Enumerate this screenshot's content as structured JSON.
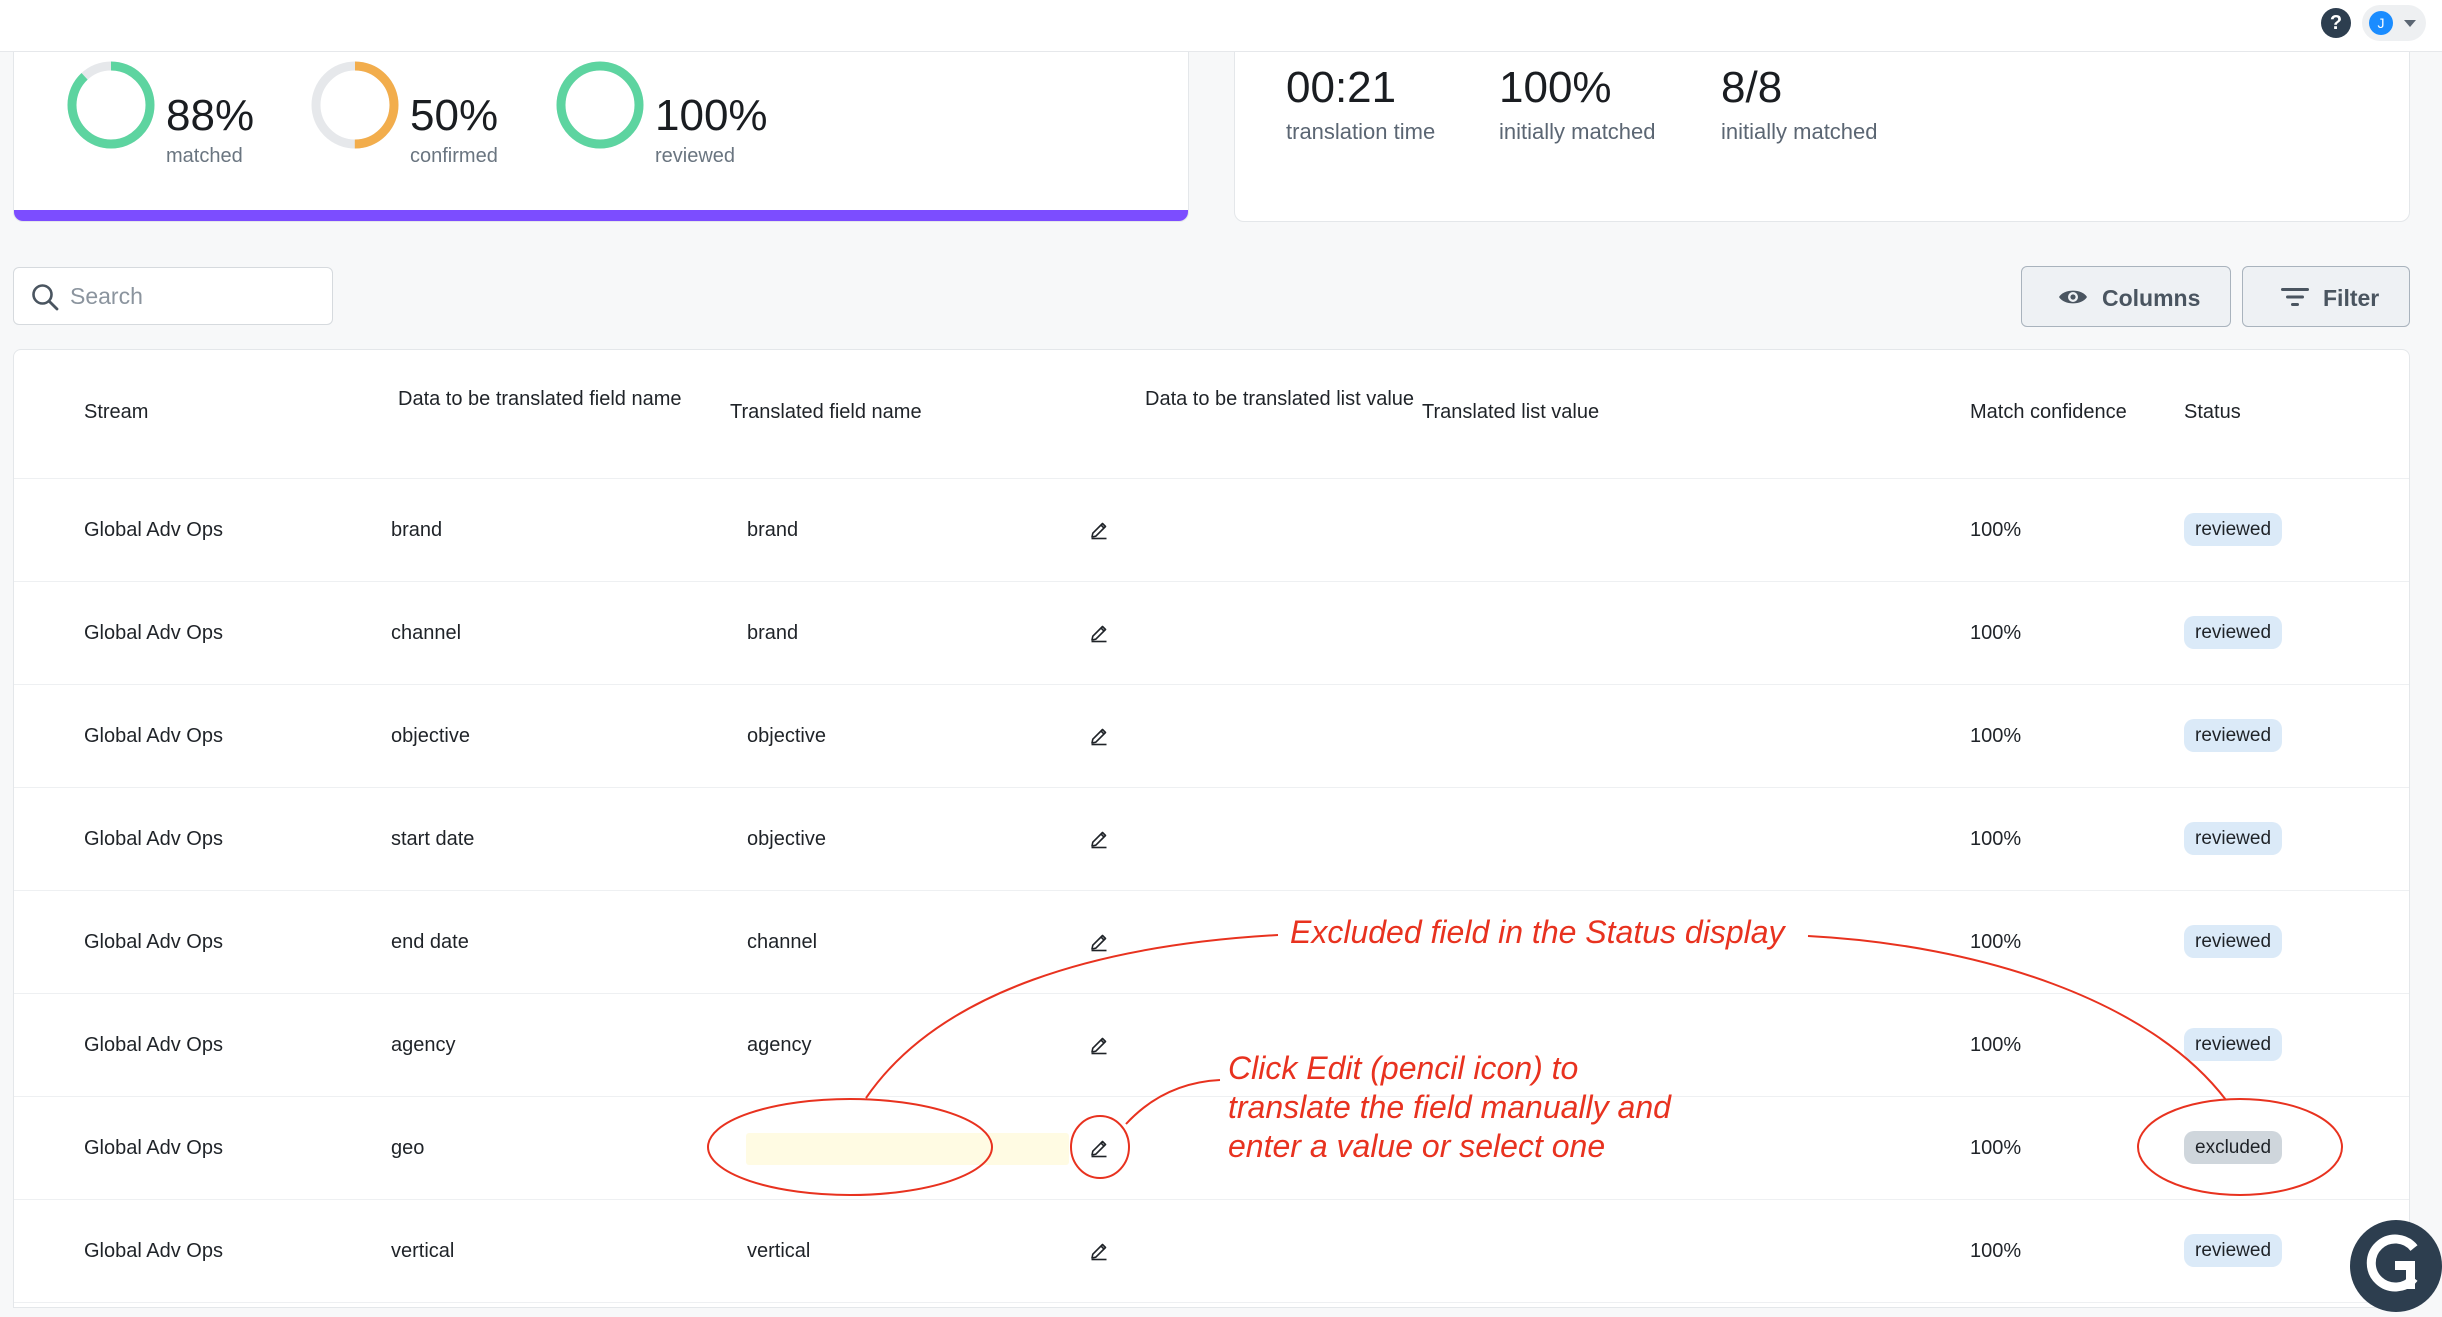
{
  "metrics": [
    {
      "value": "88%",
      "label": "matched",
      "percent": 0.88,
      "color": "#5dd4a0"
    },
    {
      "value": "50%",
      "label": "confirmed",
      "percent": 0.5,
      "color": "#f2ad4c"
    },
    {
      "value": "100%",
      "label": "reviewed",
      "percent": 1.0,
      "color": "#5dd4a0"
    }
  ],
  "stats": [
    {
      "value": "00:21",
      "label": "translation time"
    },
    {
      "value": "100%",
      "label": "initially matched"
    },
    {
      "value": "8/8",
      "label": "initially matched"
    }
  ],
  "toolbar": {
    "search_placeholder": "Search",
    "columns_label": "Columns",
    "filter_label": "Filter"
  },
  "table": {
    "headers": {
      "stream": "Stream",
      "data_field_name": "Data to be translated field name",
      "translated_field_name": "Translated field name",
      "data_list_value": "Data to be translated list value",
      "translated_list_value": "Translated list value",
      "match_confidence": "Match confidence",
      "status": "Status"
    },
    "rows": [
      {
        "stream": "Global Adv Ops",
        "field": "brand",
        "translated": "brand",
        "confidence": "100%",
        "status": "reviewed"
      },
      {
        "stream": "Global Adv Ops",
        "field": "channel",
        "translated": "brand",
        "confidence": "100%",
        "status": "reviewed"
      },
      {
        "stream": "Global Adv Ops",
        "field": "objective",
        "translated": "objective",
        "confidence": "100%",
        "status": "reviewed"
      },
      {
        "stream": "Global Adv Ops",
        "field": "start date",
        "translated": "objective",
        "confidence": "100%",
        "status": "reviewed"
      },
      {
        "stream": "Global Adv Ops",
        "field": "end date",
        "translated": "channel",
        "confidence": "100%",
        "status": "reviewed"
      },
      {
        "stream": "Global Adv Ops",
        "field": "agency",
        "translated": "agency",
        "confidence": "100%",
        "status": "reviewed"
      },
      {
        "stream": "Global Adv Ops",
        "field": "geo",
        "translated": "",
        "confidence": "100%",
        "status": "excluded"
      },
      {
        "stream": "Global Adv Ops",
        "field": "vertical",
        "translated": "vertical",
        "confidence": "100%",
        "status": "reviewed"
      }
    ]
  },
  "annotations": {
    "status_note": "Excluded field in the Status display",
    "edit_note_line1": "Click Edit (pencil icon) to",
    "edit_note_line2": "translate the field manually and",
    "edit_note_line3": "enter a value or select one",
    "color": "#e8321f"
  },
  "user": {
    "avatar_initial": "J"
  },
  "help": {
    "icon_glyph": "?"
  }
}
